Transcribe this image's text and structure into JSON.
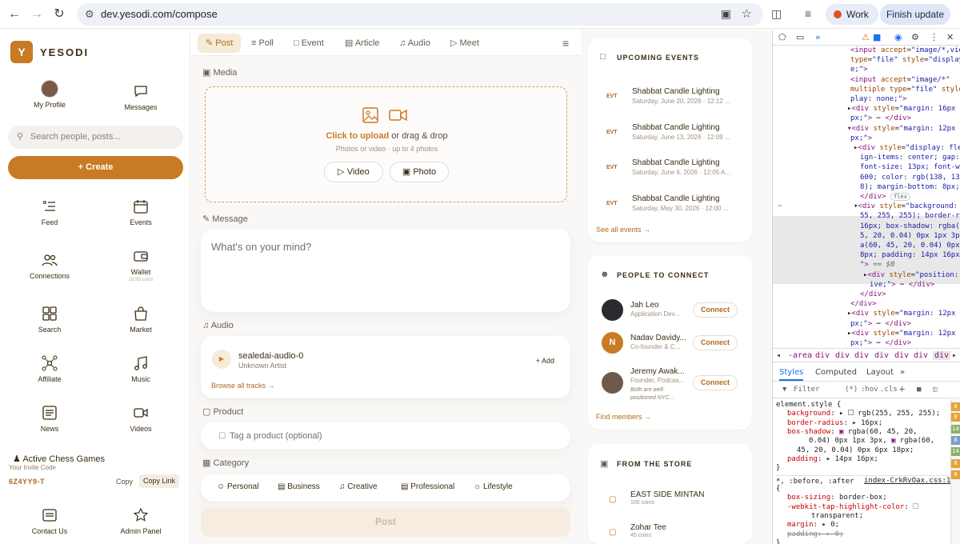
{
  "browser": {
    "url": "dev.yesodi.com/compose",
    "profile_label": "Work",
    "update_label": "Finish update"
  },
  "sidebar": {
    "brand": "YESODI",
    "logo_letter": "Y",
    "profile_label": "My Profile",
    "messages_label": "Messages",
    "search_placeholder": "Search people, posts...",
    "create_label": "Create",
    "items": [
      {
        "label": "Feed",
        "icon": "feed-icon"
      },
      {
        "label": "Events",
        "icon": "calendar-icon"
      },
      {
        "label": "Connections",
        "icon": "people-icon"
      },
      {
        "label": "Wallet",
        "icon": "wallet-icon",
        "sub": "18.95 coins"
      },
      {
        "label": "Search",
        "icon": "grid-icon"
      },
      {
        "label": "Market",
        "icon": "bag-icon"
      },
      {
        "label": "Affiliate",
        "icon": "network-icon"
      },
      {
        "label": "Music",
        "icon": "music-icon"
      },
      {
        "label": "News",
        "icon": "news-icon"
      },
      {
        "label": "Videos",
        "icon": "video-icon"
      }
    ],
    "chess_label": "Active Chess Games",
    "invite_label": "Your Invite Code",
    "invite_code": "6Z4YY9-T",
    "copy_label": "Copy",
    "copy_link_label": "Copy Link",
    "contact_label": "Contact Us",
    "admin_label": "Admin Panel"
  },
  "compose": {
    "tabs": [
      "Post",
      "Poll",
      "Event",
      "Article",
      "Audio",
      "Meet"
    ],
    "media_title": "Media",
    "upload_link": "Click to upload",
    "upload_rest": " or drag & drop",
    "upload_hint": "Photos or video · up to 4 photos",
    "video_btn": "Video",
    "photo_btn": "Photo",
    "message_title": "Message",
    "message_placeholder": "What's on your mind?",
    "audio_title": "Audio",
    "track_name": "sealedai-audio-0",
    "track_artist": "Unknown Artist",
    "add_label": "+ Add",
    "browse_label": "Browse all tracks →",
    "product_title": "Product",
    "product_placeholder": "Tag a product (optional)",
    "category_title": "Category",
    "categories": [
      "Personal",
      "Business",
      "Creative",
      "Professional",
      "Lifestyle"
    ],
    "post_label": "Post"
  },
  "rail": {
    "events_title": "UPCOMING EVENTS",
    "events": [
      {
        "tag": "EVT",
        "name": "Shabbat Candle Lighting",
        "date": "Saturday, June 20, 2026 · 12:12 ..."
      },
      {
        "tag": "EVT",
        "name": "Shabbat Candle Lighting",
        "date": "Saturday, June 13, 2026 · 12:09 ..."
      },
      {
        "tag": "EVT",
        "name": "Shabbat Candle Lighting",
        "date": "Saturday, June 6, 2026 · 12:05 A..."
      },
      {
        "tag": "EVT",
        "name": "Shabbat Candle Lighting",
        "date": "Saturday, May 30, 2026 · 12:00 ..."
      }
    ],
    "see_all_events": "See all events →",
    "people_title": "PEOPLE TO CONNECT",
    "people": [
      {
        "name": "Jah Leo",
        "role": "Application Dev...",
        "bio": "",
        "initial": "",
        "connect": "Connect"
      },
      {
        "name": "Nadav Davidy...",
        "role": "Co-founder & C...",
        "bio": "",
        "initial": "N",
        "connect": "Connect"
      },
      {
        "name": "Jeremy Awak...",
        "role": "Founder, Podcas...",
        "bio": "Both are well-positioned NYC...",
        "initial": "",
        "connect": "Connect"
      }
    ],
    "find_members": "Find members →",
    "store_title": "FROM THE STORE",
    "store": [
      {
        "name": "EAST SIDE MINTAN",
        "price": "100 coins"
      },
      {
        "name": "Zohar Tee",
        "price": "45 coins"
      }
    ]
  },
  "devtools": {
    "breadcrumb": [
      "-area",
      "div",
      "div",
      "div",
      "div",
      "div",
      "div",
      "div"
    ],
    "tabs": [
      "Styles",
      "Computed",
      "Layout"
    ],
    "filter_placeholder": "Filter",
    "filter_hov": ":hov",
    "filter_cls": ".cls",
    "style_selector": "element.style {",
    "rule_selector": "*, :before, :after",
    "rule_source": "index-CrkRvOax.css:1",
    "flex_badge": "flex",
    "dollar": "== $0"
  },
  "colors": {
    "accent": "#c87a24",
    "accent_soft": "#f6ead9",
    "text": "#3c2d14"
  }
}
